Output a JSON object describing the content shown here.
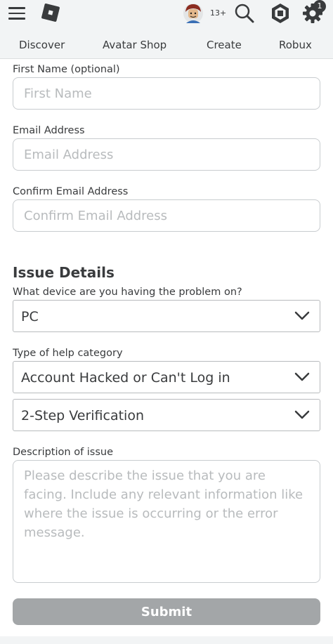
{
  "header": {
    "age_label": "13+",
    "notification_count": "1",
    "icons": [
      "menu-icon",
      "roblox-logo",
      "avatar",
      "search-icon",
      "robux-icon",
      "settings-icon"
    ]
  },
  "nav": {
    "items": [
      "Discover",
      "Avatar Shop",
      "Create",
      "Robux"
    ]
  },
  "form": {
    "first_name": {
      "label": "First Name (optional)",
      "placeholder": "First Name",
      "value": ""
    },
    "email": {
      "label": "Email Address",
      "placeholder": "Email Address",
      "value": ""
    },
    "confirm_email": {
      "label": "Confirm Email Address",
      "placeholder": "Confirm Email Address",
      "value": ""
    },
    "section_title": "Issue Details",
    "device": {
      "label": "What device are you having the problem on?",
      "selected": "PC"
    },
    "help_category": {
      "label": "Type of help category",
      "selected": "Account Hacked or Can't Log in"
    },
    "subcategory": {
      "selected": "2-Step Verification"
    },
    "description": {
      "label": "Description of issue",
      "placeholder": "Please describe the issue that you are facing. Include any relevant information like where the issue is occurring or the error message.",
      "value": ""
    },
    "submit_label": "Submit"
  },
  "colors": {
    "header_bg": "#f2f4f5",
    "text": "#393b3d",
    "border": "#c8cccf",
    "placeholder": "#b8bbbd",
    "submit_bg": "#a3a6a8"
  }
}
